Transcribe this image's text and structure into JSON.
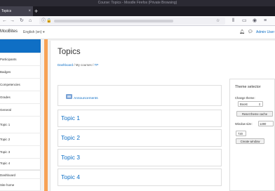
{
  "browser": {
    "window_title": "Course: Topics - Moodle Firefox (Private Browsing)",
    "tab_label": "Topics",
    "new_tab_symbol": "+",
    "tab_close_symbol": "×"
  },
  "header": {
    "site_name": "MooBites",
    "language": "English (en) ▾",
    "user_name": "Admin User"
  },
  "drawer": {
    "items": [
      {
        "label": "",
        "active": true
      },
      {
        "label": "Participants",
        "active": false
      },
      {
        "label": "Badges",
        "active": false
      },
      {
        "label": "Competencies",
        "active": false
      },
      {
        "label": "Grades",
        "active": false
      },
      {
        "label": "General",
        "active": false
      },
      {
        "label": "Topic 1",
        "active": false
      },
      {
        "label": "Topic 2",
        "active": false
      },
      {
        "label": "Topic 3",
        "active": false
      },
      {
        "label": "Topic 4",
        "active": false
      },
      {
        "label": "Dashboard",
        "active": false
      },
      {
        "label": "Site home",
        "active": false
      }
    ]
  },
  "main": {
    "page_title": "Topics",
    "breadcrumb": {
      "item1": "Dashboard",
      "sep": " / ",
      "item2": "My courses",
      "item3": "TP"
    },
    "announcements_link": "Announcements",
    "topics": [
      "Topic 1",
      "Topic 2",
      "Topic 3",
      "Topic 4"
    ]
  },
  "theme_selector": {
    "title": "Theme selector",
    "change_theme_label": "Change theme:",
    "theme_value": "Boost",
    "reset_button": "Reset theme cache",
    "window_size_label": "Window size:",
    "width_value": "1280",
    "height_value": "720",
    "create_button": "Create window"
  },
  "colors": {
    "accent": "#0f6fc5",
    "boost_orange": "#f98012"
  }
}
